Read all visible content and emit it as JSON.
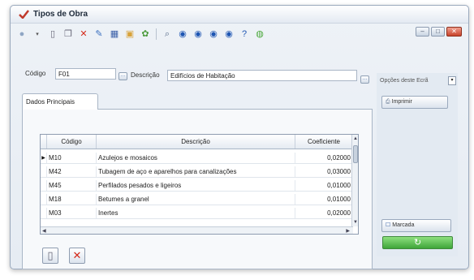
{
  "window": {
    "title": "Tipos de Obra",
    "accent": "#2d5aa0"
  },
  "toolbar": {
    "icons": [
      "circle-icon",
      "new-doc-icon",
      "copy-doc-icon",
      "delete-icon",
      "edit-icon",
      "grid-icon",
      "image-icon",
      "refresh-icon",
      "search-icon",
      "first-icon",
      "prev-icon",
      "next-icon",
      "last-icon",
      "help-icon",
      "exit-icon"
    ]
  },
  "header": {
    "codigo_label": "Código",
    "codigo_value": "F01",
    "descricao_label": "Descrição",
    "descricao_value": "Edifícios de Habitação"
  },
  "options": {
    "label": "Opções deste Ecrã"
  },
  "tabs": [
    {
      "label": "Dados Principais"
    }
  ],
  "table": {
    "columns": [
      "Código",
      "Descrição",
      "Coeficiente"
    ],
    "rows": [
      {
        "code": "M10",
        "desc": "Azulejos e mosaicos",
        "coef": "0,02000"
      },
      {
        "code": "M42",
        "desc": "Tubagem de aço e aparelhos para canalizações",
        "coef": "0,03000"
      },
      {
        "code": "M45",
        "desc": "Perfilados pesados e ligeiros",
        "coef": "0,01000"
      },
      {
        "code": "M18",
        "desc": "Betumes a granel",
        "coef": "0,01000"
      },
      {
        "code": "M03",
        "desc": "Inertes",
        "coef": "0,02000"
      }
    ]
  },
  "side": {
    "imprimir_label": "Imprimir",
    "marcada_label": "Marcada"
  }
}
